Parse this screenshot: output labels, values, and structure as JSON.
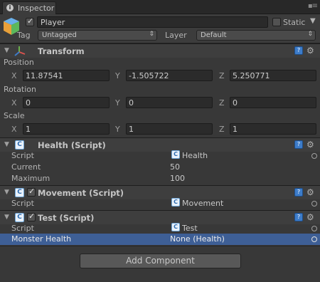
{
  "tab": {
    "title": "Inspector"
  },
  "object": {
    "name": "Player",
    "static_label": "Static",
    "tag_label": "Tag",
    "tag_value": "Untagged",
    "layer_label": "Layer",
    "layer_value": "Default"
  },
  "transform": {
    "title": "Transform",
    "position_label": "Position",
    "rotation_label": "Rotation",
    "scale_label": "Scale",
    "position": {
      "x": "11.87541",
      "y": "-1.505722",
      "z": "5.250771"
    },
    "rotation": {
      "x": "0",
      "y": "0",
      "z": "0"
    },
    "scale": {
      "x": "1",
      "y": "1",
      "z": "1"
    },
    "axes": {
      "x": "X",
      "y": "Y",
      "z": "Z"
    }
  },
  "health": {
    "title": "Health (Script)",
    "script_label": "Script",
    "script_value": "Health",
    "current_label": "Current",
    "current_value": "50",
    "maximum_label": "Maximum",
    "maximum_value": "100"
  },
  "movement": {
    "title": "Movement (Script)",
    "script_label": "Script",
    "script_value": "Movement"
  },
  "test": {
    "title": "Test (Script)",
    "script_label": "Script",
    "script_value": "Test",
    "monster_label": "Monster Health",
    "monster_value": "None (Health)"
  },
  "add_component_label": "Add Component",
  "colors": {
    "background": "#383838",
    "selection": "#3e5f96"
  }
}
